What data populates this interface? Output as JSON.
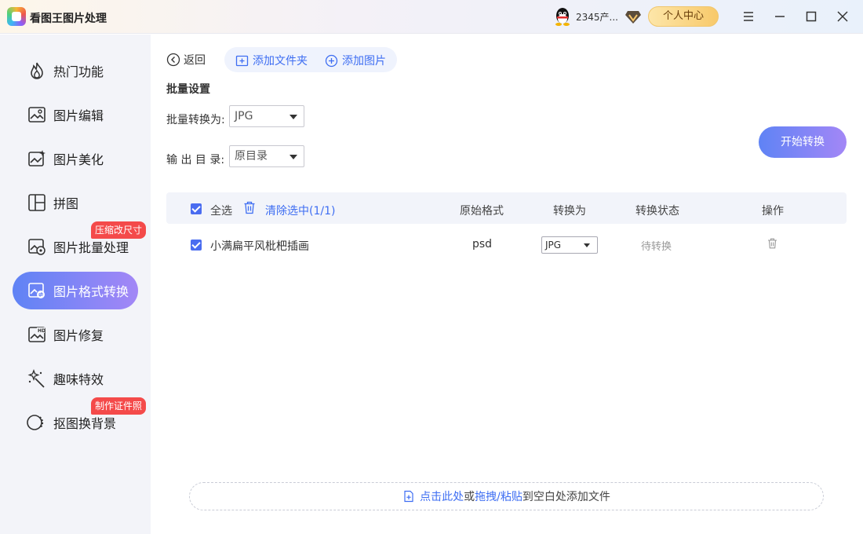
{
  "app": {
    "title": "看图王图片处理"
  },
  "header": {
    "username": "2345产...",
    "user_center": "个人中心"
  },
  "sidebar": {
    "items": [
      {
        "label": "热门功能",
        "icon": "fire-icon"
      },
      {
        "label": "图片编辑",
        "icon": "image-edit-icon"
      },
      {
        "label": "图片美化",
        "icon": "image-beautify-icon"
      },
      {
        "label": "拼图",
        "icon": "collage-icon"
      },
      {
        "label": "图片批量处理",
        "icon": "batch-image-icon",
        "badge": "压缩改尺寸"
      },
      {
        "label": "图片格式转换",
        "icon": "format-convert-icon",
        "active": true
      },
      {
        "label": "图片修复",
        "icon": "hd-repair-icon"
      },
      {
        "label": "趣味特效",
        "icon": "magic-wand-icon"
      },
      {
        "label": "抠图换背景",
        "icon": "cutout-icon",
        "badge": "制作证件照"
      }
    ]
  },
  "toolbar": {
    "back": "返回",
    "add_folder": "添加文件夹",
    "add_image": "添加图片"
  },
  "settings": {
    "title": "批量设置",
    "convert_label": "批量转换为:",
    "convert_value": "JPG",
    "output_label": "输 出 目 录:",
    "output_value": "原目录",
    "start_button": "开始转换"
  },
  "table": {
    "select_all": "全选",
    "clear_selected": "清除选中(1/1)",
    "columns": [
      "原始格式",
      "转换为",
      "转换状态",
      "操作"
    ],
    "rows": [
      {
        "name": "小满扁平风枇杷插画",
        "original_format": "psd",
        "convert_to": "JPG",
        "status": "待转换"
      }
    ]
  },
  "dropzone": {
    "part1": "点击此处",
    "part2": "或",
    "part3": "拖拽/粘贴",
    "part4": "到空白处添加文件"
  },
  "colors": {
    "accent": "#4a6cf0",
    "badge": "#f44a4a"
  }
}
